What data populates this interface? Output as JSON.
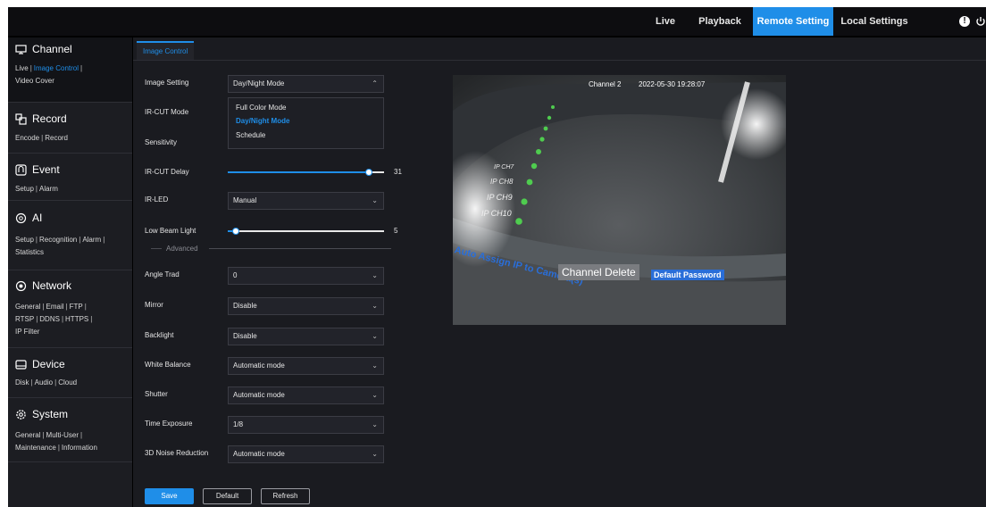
{
  "topnav": {
    "items": [
      {
        "label": "Live",
        "active": false
      },
      {
        "label": "Playback",
        "active": false
      },
      {
        "label": "Remote Setting",
        "active": true
      },
      {
        "label": "Local Settings",
        "active": false
      }
    ],
    "icons": [
      "alert-icon",
      "power-icon"
    ]
  },
  "sidebar": {
    "channel": {
      "title": "Channel",
      "icon": "monitor-icon",
      "links": [
        "Live",
        "Image Control",
        "Video Cover"
      ]
    },
    "record": {
      "title": "Record",
      "icon": "record-icon",
      "links": [
        "Encode",
        "Record"
      ]
    },
    "event": {
      "title": "Event",
      "icon": "event-icon",
      "links": [
        "Setup",
        "Alarm"
      ]
    },
    "ai": {
      "title": "AI",
      "icon": "ai-icon",
      "links": [
        "Setup",
        "Recognition",
        "Alarm",
        "Statistics"
      ]
    },
    "network": {
      "title": "Network",
      "icon": "network-icon",
      "links": [
        "General",
        "Email",
        "FTP",
        "RTSP",
        "DDNS",
        "HTTPS",
        "IP Filter"
      ]
    },
    "device": {
      "title": "Device",
      "icon": "disk-icon",
      "links": [
        "Disk",
        "Audio",
        "Cloud"
      ]
    },
    "system": {
      "title": "System",
      "icon": "gear-icon",
      "links": [
        "General",
        "Multi-User",
        "Maintenance",
        "Information"
      ]
    }
  },
  "tab": {
    "label": "Image Control"
  },
  "form": {
    "image_setting": {
      "label": "Image Setting",
      "value": "Day/Night Mode"
    },
    "dropdown_options": [
      "Full Color Mode",
      "Day/Night Mode",
      "Schedule"
    ],
    "ircut_mode": {
      "label": "IR-CUT Mode"
    },
    "sensitivity": {
      "label": "Sensitivity"
    },
    "ircut_delay": {
      "label": "IR-CUT Delay",
      "value": "31",
      "fraction": 0.9
    },
    "ir_led": {
      "label": "IR-LED",
      "value": "Manual"
    },
    "low_beam": {
      "label": "Low Beam Light",
      "value": "5",
      "fraction": 0.05
    },
    "advanced": "Advanced",
    "angle_trad": {
      "label": "Angle Trad",
      "value": "0"
    },
    "mirror": {
      "label": "Mirror",
      "value": "Disable"
    },
    "backlight": {
      "label": "Backlight",
      "value": "Disable"
    },
    "white_balance": {
      "label": "White Balance",
      "value": "Automatic mode"
    },
    "shutter": {
      "label": "Shutter",
      "value": "Automatic mode"
    },
    "time_exposure": {
      "label": "Time Exposure",
      "value": "1/8"
    },
    "noise_reduction": {
      "label": "3D Noise Reduction",
      "value": "Automatic mode"
    }
  },
  "buttons": {
    "save": "Save",
    "default": "Default",
    "refresh": "Refresh"
  },
  "preview": {
    "channel_label": "Channel 2",
    "timestamp": "2022-05-30 19:28:07",
    "ch_labels": [
      "IP CH7",
      "IP CH8",
      "IP CH9",
      "IP CH10"
    ],
    "banner_text": "Auto Assign IP to Camera(s)",
    "channel_delete": "Channel Delete",
    "default_password": "Default Password"
  },
  "colors": {
    "accent": "#1f8ee8",
    "background": "#17181c",
    "topbar": "#0d0d10"
  }
}
